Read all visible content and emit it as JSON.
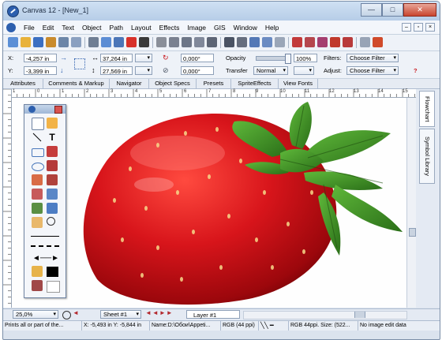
{
  "window": {
    "title": "Canvas 12 - [New_1]",
    "minimize": "—",
    "maximize": "□",
    "close": "✕"
  },
  "menu": [
    "File",
    "Edit",
    "Text",
    "Object",
    "Path",
    "Layout",
    "Effects",
    "Image",
    "GIS",
    "Window",
    "Help"
  ],
  "mdi": {
    "minimize": "–",
    "restore": "▫",
    "close": "×"
  },
  "props": {
    "x_label": "X:",
    "x_value": "-4,257 in",
    "y_label": "Y:",
    "y_value": "-3,399 in",
    "width_value": "37,264 in",
    "height_value": "27,569 in",
    "angle1": "0,000°",
    "angle2": "0,000°",
    "opacity_label": "Opacity",
    "opacity_value": "100%",
    "opacity_level": 1.0,
    "transfer_label": "Transfer",
    "transfer_value": "Normal",
    "filters_label": "Filters:",
    "filters_value": "Choose Filter",
    "adjust_label": "Adjust:",
    "adjust_value": "Choose Filter",
    "help_icon": "?"
  },
  "tabs": [
    "Attributes",
    "Comments & Markup",
    "Navigator",
    "Object Specs",
    "Presets",
    "SpriteEffects",
    "View Fonts"
  ],
  "side_tabs": [
    "Flowchart",
    "Symbol Library"
  ],
  "ruler": [
    "1",
    "0",
    "1",
    "2",
    "3",
    "4",
    "5",
    "6",
    "7",
    "8",
    "9",
    "10",
    "11",
    "12",
    "13",
    "14",
    "15"
  ],
  "bottom": {
    "zoom": "25,0%",
    "sheet": "Sheet #1",
    "layer": "Layer #1"
  },
  "status": [
    "Prints all or part of the...",
    "X: -5,493 in Y: -5,844 in",
    "Name:D:\\Обои\\Appeti...",
    "RGB (44 ppi)",
    "RGB 44ppi. Size: (522...",
    "No image edit data"
  ],
  "colors": {
    "accent": "#2d5fae",
    "strawberry": "#c8141a",
    "leaf": "#3c8f23"
  }
}
